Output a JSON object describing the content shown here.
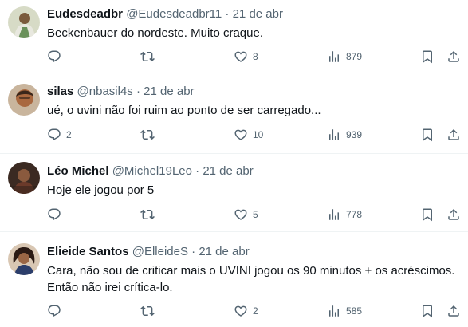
{
  "tweets": [
    {
      "name": "Eudesdeadbr",
      "handle": "@Eudesdeadbr11",
      "separator": "·",
      "time": "21 de abr",
      "lines": [
        "Beckenbauer do nordeste. Muito craque."
      ],
      "replies": "",
      "retweets": "",
      "likes": "8",
      "views": "879"
    },
    {
      "name": "silas",
      "handle": "@nbasil4s",
      "separator": "·",
      "time": "21 de abr",
      "lines": [
        "ué, o uvini não foi ruim ao ponto de ser carregado..."
      ],
      "replies": "2",
      "retweets": "",
      "likes": "10",
      "views": "939"
    },
    {
      "name": "Léo Michel",
      "handle": "@Michel19Leo",
      "separator": "·",
      "time": "21 de abr",
      "lines": [
        "Hoje ele jogou por 5"
      ],
      "replies": "",
      "retweets": "",
      "likes": "5",
      "views": "778"
    },
    {
      "name": "Elieide Santos",
      "handle": "@ElleideS",
      "separator": "·",
      "time": "21 de abr",
      "lines": [
        "Cara, não sou de criticar mais o  UVINI jogou os 90 minutos + os acréscimos.",
        "Então não irei crítica-lo."
      ],
      "replies": "",
      "retweets": "",
      "likes": "2",
      "views": "585"
    }
  ],
  "icons": {
    "reply": "reply-icon",
    "retweet": "retweet-icon",
    "like": "heart-icon",
    "views": "views-icon",
    "bookmark": "bookmark-icon",
    "share": "share-icon"
  },
  "colors": {
    "text": "#0f1419",
    "secondary": "#536471",
    "divider": "#eff3f4"
  }
}
